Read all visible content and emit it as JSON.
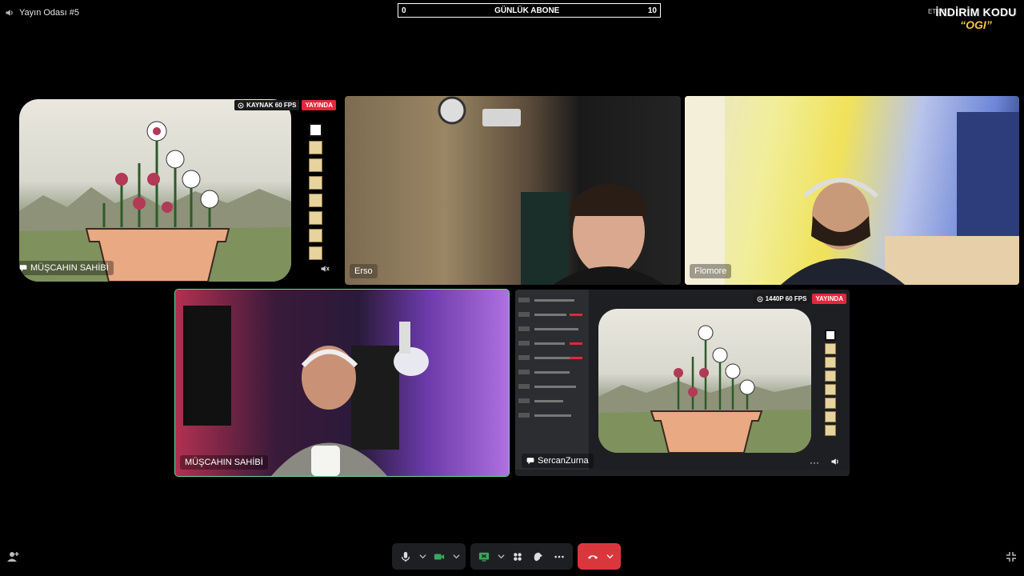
{
  "header": {
    "room_title": "Yayın Odası #5",
    "sub_goal": {
      "label": "GÜNLÜK ABONE",
      "current": "0",
      "target": "10"
    },
    "status_badge": "ETKİN",
    "promo_line1": "İNDİRİM KODU",
    "promo_line2": "“OGI”"
  },
  "tiles": {
    "tile1": {
      "name": "MÜŞCAHIN SAHİBİ",
      "fps": "KAYNAK 60 FPS",
      "live": "YAYINDA"
    },
    "tile2": {
      "name": "Erso"
    },
    "tile3": {
      "name": "Flomore"
    },
    "tile4": {
      "name": "MÜŞCAHIN SAHİBİ"
    },
    "tile5": {
      "name": "SercanZurna",
      "fps": "1440P 60 FPS",
      "live": "YAYINDA"
    }
  },
  "colors": {
    "live": "#e5263b",
    "hangup": "#da373c",
    "active_outline": "#6bd69a",
    "promo_accent": "#f5c542"
  },
  "icons": [
    "speaker-icon",
    "eye-icon",
    "mute-icon",
    "mic-icon",
    "camera-icon",
    "screen-share-icon",
    "activities-icon",
    "soundboard-icon",
    "more-icon",
    "hangup-icon",
    "add-user-icon",
    "fullscreen-icon",
    "volume-icon",
    "chat-bubble-icon"
  ]
}
